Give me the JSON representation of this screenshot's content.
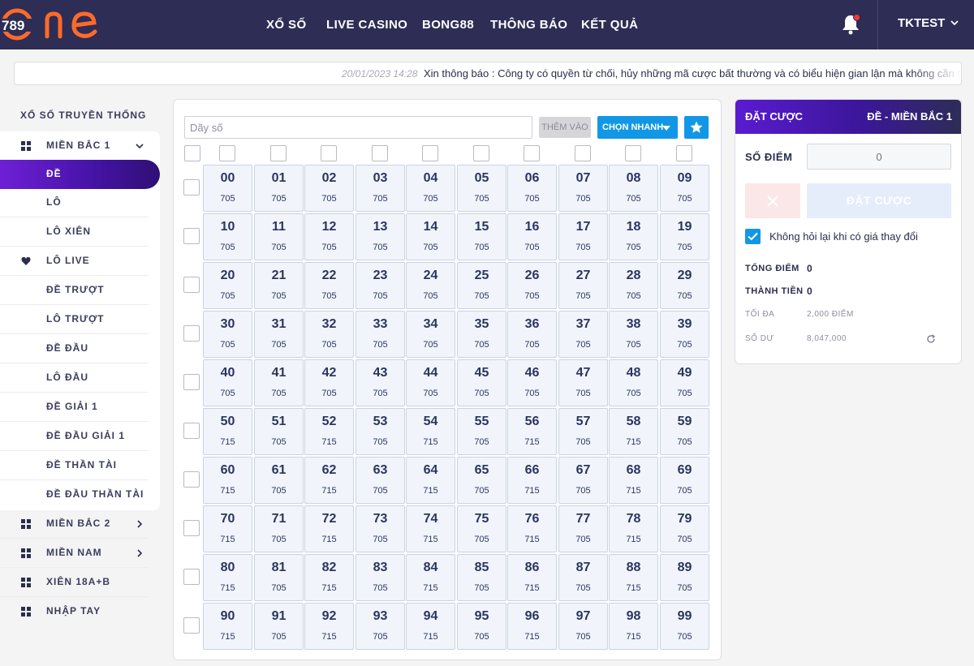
{
  "header": {
    "logo_text": "789",
    "logo_word": "one",
    "nav": [
      "XỔ SỐ",
      "LIVE CASINO",
      "BONG88",
      "THÔNG BÁO",
      "KẾT QUẢ"
    ],
    "username": "TKTEST",
    "colors": {
      "bar": "#2d2d55",
      "logo": "#ff6a2a",
      "notify_dot": "#ff3535"
    }
  },
  "marquee": {
    "date": "20/01/2023 14:28",
    "text": "Xin thông báo : Công ty có quyền từ chối, hủy những mã cược bất thường và có biểu hiện gian lận mà không cần thô"
  },
  "sidebar": {
    "title": "XỔ SỐ TRUYỀN THỐNG",
    "items": [
      {
        "label": "MIỀN BẮC 1",
        "icon": "grid-icon",
        "chevron": "chevron-down-icon"
      },
      {
        "label": "ĐỀ",
        "active": true
      },
      {
        "label": "LÔ"
      },
      {
        "label": "LÔ XIÊN"
      },
      {
        "label": "LÔ LIVE",
        "icon": "heart-icon"
      },
      {
        "label": "ĐỀ TRƯỢT"
      },
      {
        "label": "LÔ TRƯỢT"
      },
      {
        "label": "ĐỀ ĐẦU"
      },
      {
        "label": "LÔ ĐẦU"
      },
      {
        "label": "ĐỀ GIẢI 1"
      },
      {
        "label": "ĐỀ ĐẦU GIẢI 1"
      },
      {
        "label": "ĐỀ THẦN TÀI"
      },
      {
        "label": "ĐỀ ĐẦU THẦN TÀI"
      },
      {
        "label": "MIỀN BẮC 2",
        "icon": "grid-icon",
        "chevron": "chevron-right-icon"
      },
      {
        "label": "MIỀN NAM",
        "icon": "grid-icon",
        "chevron": "chevron-right-icon"
      },
      {
        "label": "XIÊN 18A+B",
        "icon": "grid-icon"
      },
      {
        "label": "NHẬP TAY",
        "icon": "grid-icon"
      }
    ]
  },
  "board": {
    "input_placeholder": "Dãy số",
    "add_button": "THÊM VÀO",
    "quick_button": "CHỌN NHANH",
    "accent": "#1297e6",
    "prices": [
      [
        705,
        705,
        705,
        705,
        705,
        705,
        705,
        705,
        705,
        705
      ],
      [
        705,
        705,
        705,
        705,
        705,
        705,
        705,
        705,
        705,
        705
      ],
      [
        705,
        705,
        705,
        705,
        705,
        705,
        705,
        705,
        705,
        705
      ],
      [
        705,
        705,
        705,
        705,
        705,
        705,
        705,
        705,
        705,
        705
      ],
      [
        705,
        705,
        705,
        705,
        705,
        705,
        705,
        705,
        705,
        705
      ],
      [
        715,
        705,
        715,
        705,
        715,
        705,
        715,
        705,
        715,
        705
      ],
      [
        715,
        705,
        715,
        705,
        715,
        705,
        715,
        705,
        715,
        705
      ],
      [
        715,
        705,
        715,
        705,
        715,
        705,
        715,
        705,
        715,
        705
      ],
      [
        715,
        705,
        715,
        705,
        715,
        705,
        715,
        705,
        715,
        705
      ],
      [
        715,
        705,
        715,
        705,
        715,
        705,
        715,
        705,
        715,
        705
      ]
    ]
  },
  "bet": {
    "title": "ĐẶT CƯỢC",
    "game": "ĐỀ - MIỀN BẮC 1",
    "points_label": "SỐ ĐIỂM",
    "points_value": "0",
    "submit_label": "ĐẶT CƯỢC",
    "no_ask_label": "Không hỏi lại khi có giá thay đổi",
    "total_points_label": "TỔNG ĐIỂM",
    "total_points_value": "0",
    "amount_label": "THÀNH TIỀN",
    "amount_value": "0",
    "max_label": "TỐI ĐA",
    "max_value": "2,000 ĐIỂM",
    "balance_label": "SỐ DƯ",
    "balance_value": "8,047,000"
  }
}
